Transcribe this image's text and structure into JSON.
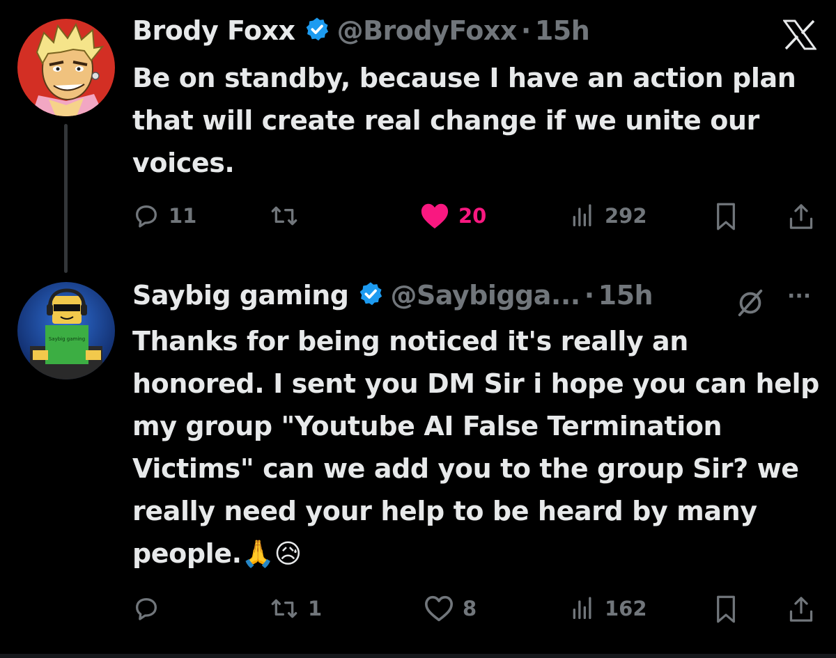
{
  "tweets": [
    {
      "name": "Brody Foxx",
      "handle": "@BrodyFoxx",
      "time": "15h",
      "text": "Be on standby, because I have an action plan that will create real change if we unite our voices.",
      "replies": "11",
      "retweets": "",
      "likes": "20",
      "views": "292",
      "liked": true
    },
    {
      "name": "Saybig gaming",
      "handle": "@Saybigga...",
      "time": "15h",
      "text": "Thanks for being noticed it's really an honored. I sent you DM Sir i hope you can help my group \"Youtube AI False Termination Victims\" can we add you to the group Sir? we really need your help to be heard by many people.",
      "emojis": "🙏😥",
      "replies": "",
      "retweets": "1",
      "likes": "8",
      "views": "162",
      "liked": false,
      "avatar_shirt_text": "Saybig gaming"
    }
  ],
  "separator": "·",
  "more_menu": "···",
  "colors": {
    "background": "#000000",
    "text": "#e7e9ea",
    "muted": "#71767b",
    "verified": "#1d9bf0",
    "like": "#f91880"
  },
  "icons": [
    "x-logo-icon",
    "verified-icon",
    "reply-icon",
    "retweet-icon",
    "like-icon",
    "views-icon",
    "bookmark-icon",
    "share-icon",
    "grok-icon",
    "more-icon"
  ]
}
